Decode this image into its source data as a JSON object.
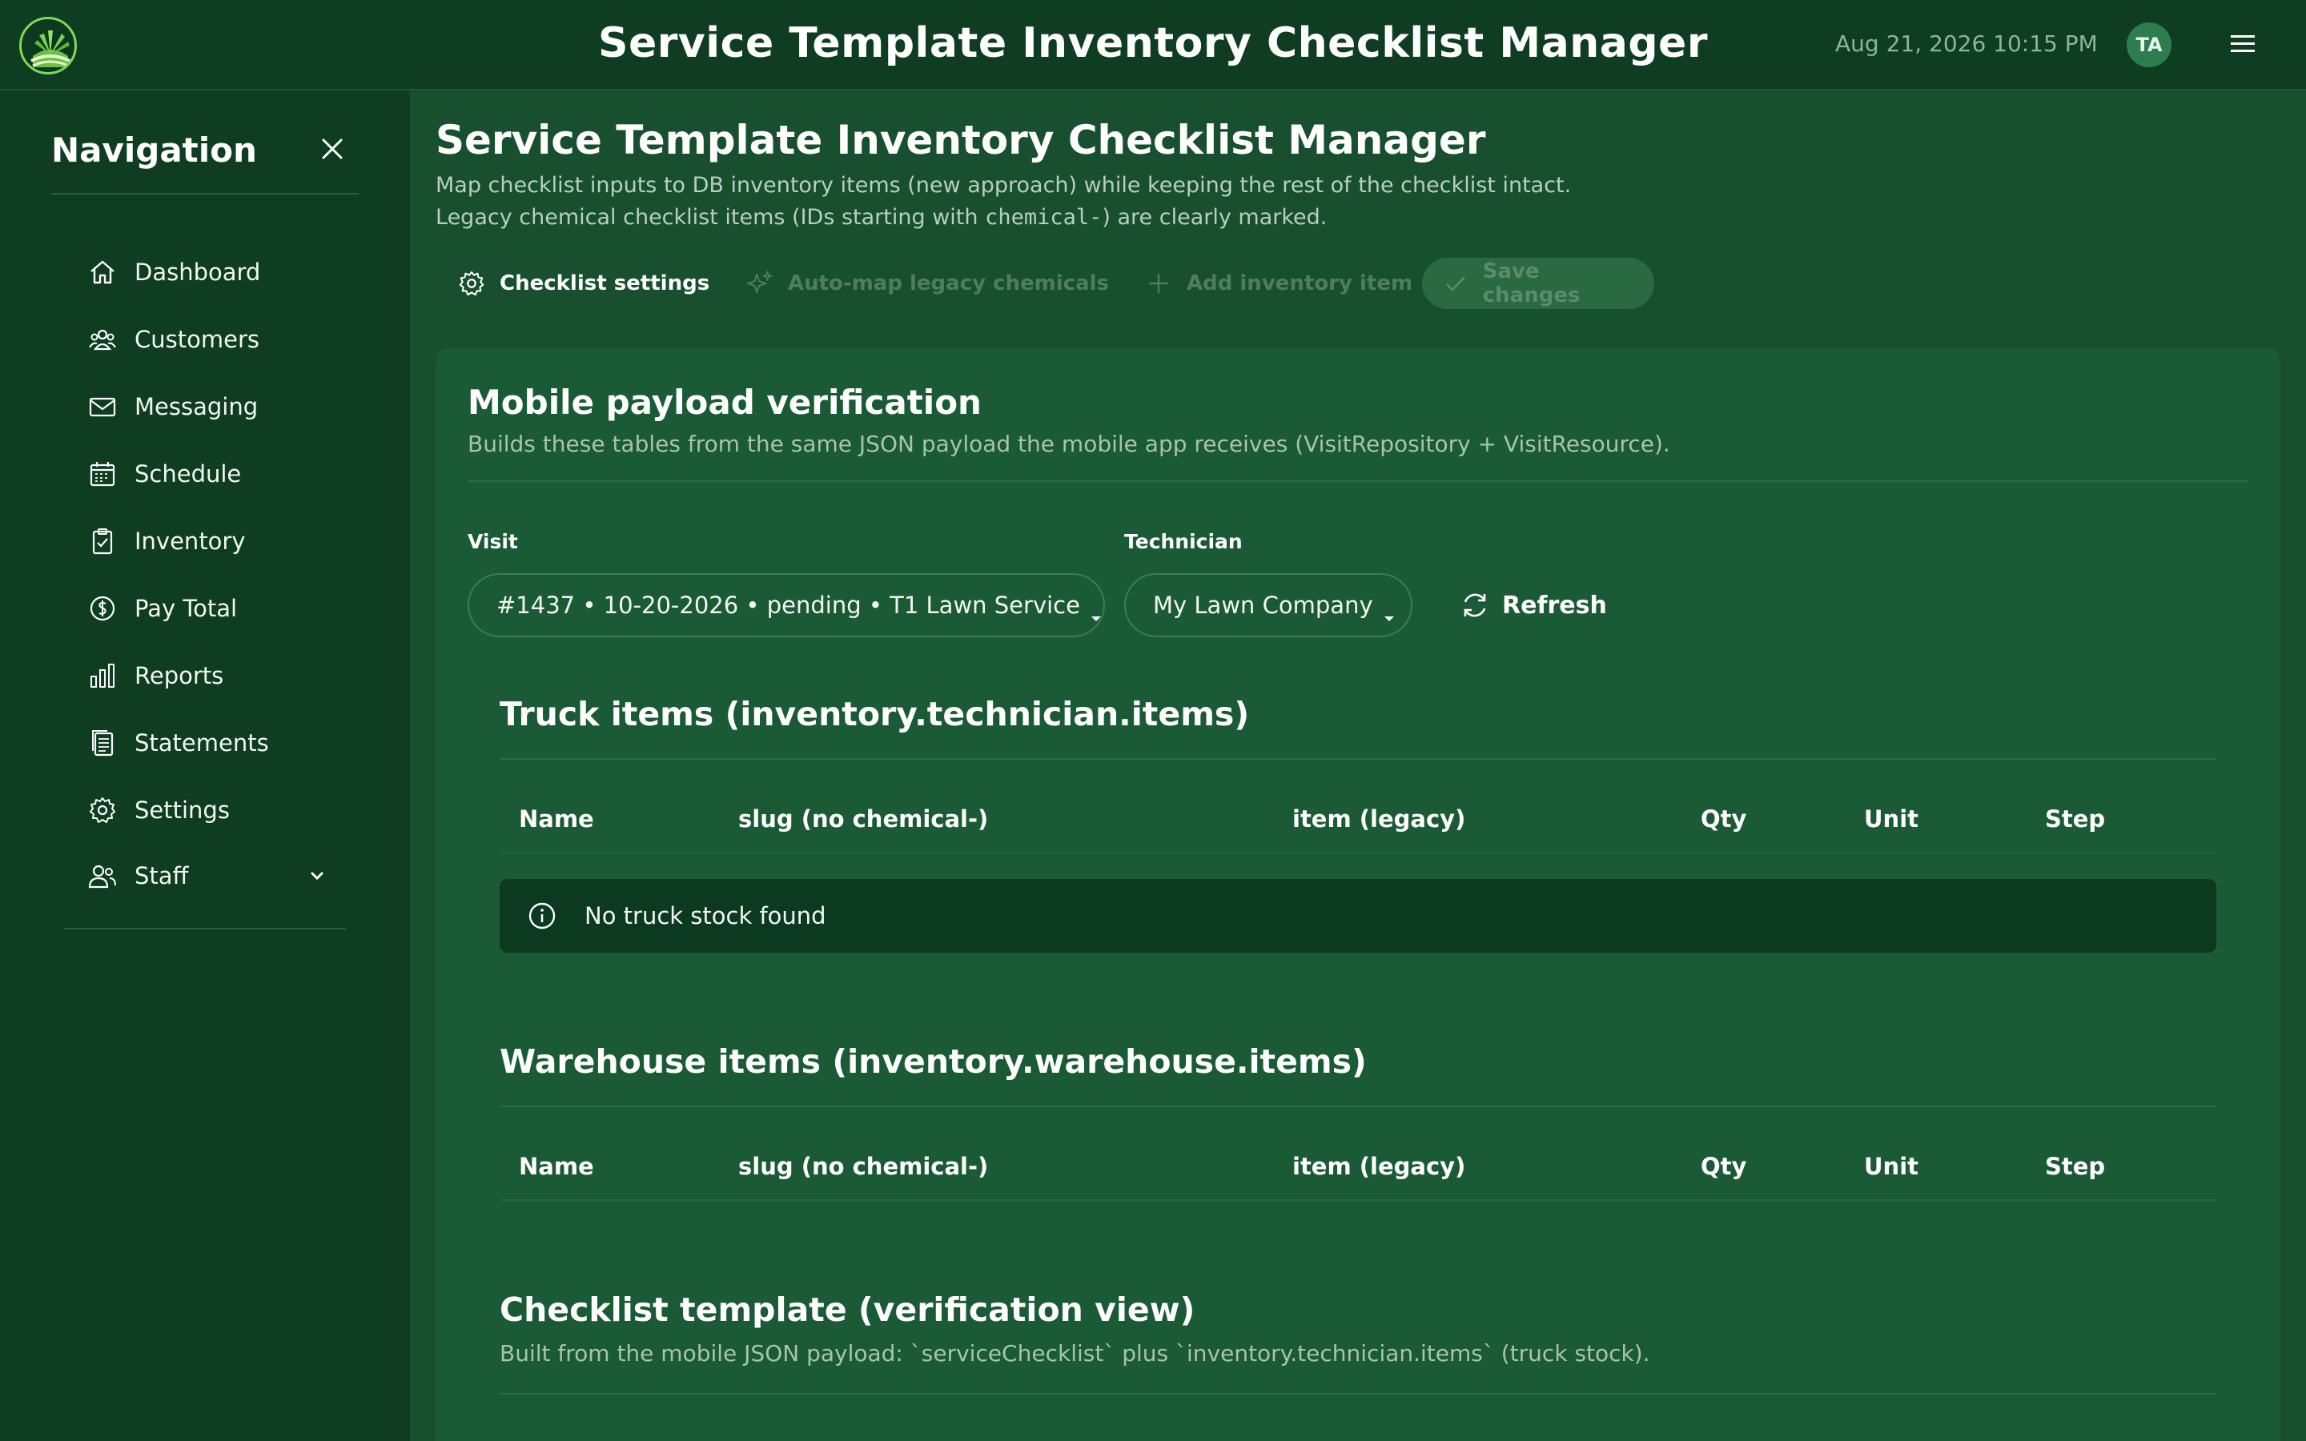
{
  "header": {
    "app_title": "Service Template Inventory Checklist Manager",
    "datetime": "Aug 21, 2026 10:15 PM",
    "avatar_initials": "TA",
    "logo_icon": "grass-logo-icon",
    "menu_icon": "hamburger-menu-icon"
  },
  "sidebar": {
    "heading": "Navigation",
    "items": [
      {
        "label": "Dashboard",
        "icon": "home-icon"
      },
      {
        "label": "Customers",
        "icon": "users-group-icon"
      },
      {
        "label": "Messaging",
        "icon": "envelope-icon"
      },
      {
        "label": "Schedule",
        "icon": "calendar-icon"
      },
      {
        "label": "Inventory",
        "icon": "clipboard-check-icon"
      },
      {
        "label": "Pay Total",
        "icon": "dollar-circle-icon"
      },
      {
        "label": "Reports",
        "icon": "bar-chart-icon"
      },
      {
        "label": "Statements",
        "icon": "documents-icon"
      },
      {
        "label": "Settings",
        "icon": "gear-icon"
      },
      {
        "label": "Staff",
        "icon": "staff-icon"
      }
    ]
  },
  "page": {
    "title": "Service Template Inventory Checklist Manager",
    "desc_line1": "Map checklist inputs to DB inventory items (new approach) while keeping the rest of the checklist intact.",
    "desc_line2_pre": "Legacy chemical checklist items (IDs starting with ",
    "desc_line2_code": "chemical-",
    "desc_line2_post": ") are clearly marked."
  },
  "toolbar": {
    "settings_label": "Checklist settings",
    "automap_label": "Auto-map legacy chemicals",
    "add_label": "Add inventory item",
    "save_label": "Save changes"
  },
  "verification": {
    "title": "Mobile payload verification",
    "subtitle": "Builds these tables from the same JSON payload the mobile app receives (VisitRepository + VisitResource).",
    "visit_label": "Visit",
    "visit_value": "#1437 • 10-20-2026 • pending • T1 Lawn Service",
    "technician_label": "Technician",
    "technician_value": "My Lawn Company",
    "refresh_label": "Refresh"
  },
  "truck": {
    "title": "Truck items (inventory.technician.items)",
    "columns": [
      "Name",
      "slug (no chemical-)",
      "item (legacy)",
      "Qty",
      "Unit",
      "Step"
    ],
    "empty_message": "No truck stock found"
  },
  "warehouse": {
    "title": "Warehouse items (inventory.warehouse.items)",
    "columns": [
      "Name",
      "slug (no chemical-)",
      "item (legacy)",
      "Qty",
      "Unit",
      "Step"
    ]
  },
  "checklist": {
    "title": "Checklist template (verification view)",
    "subtitle": "Built from the mobile JSON payload: `serviceChecklist` plus `inventory.technician.items` (truck stock)."
  }
}
